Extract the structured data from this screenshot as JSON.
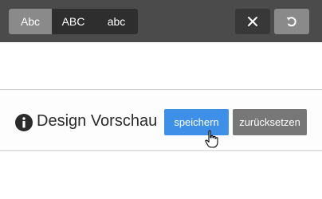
{
  "toolbar": {
    "case_buttons": [
      {
        "label": "Abc",
        "active": true
      },
      {
        "label": "ABC",
        "active": false
      },
      {
        "label": "abc",
        "active": false
      }
    ],
    "close_icon": "close-icon",
    "reset_icon": "undo-icon"
  },
  "preview": {
    "label": "Design Vorschau",
    "info_icon": "info-icon",
    "save_label": "speichern",
    "reset_label": "zurücksetzen"
  },
  "colors": {
    "toolbar_bg": "#4b4b4b",
    "primary": "#3d8fe8",
    "secondary": "#777777"
  }
}
